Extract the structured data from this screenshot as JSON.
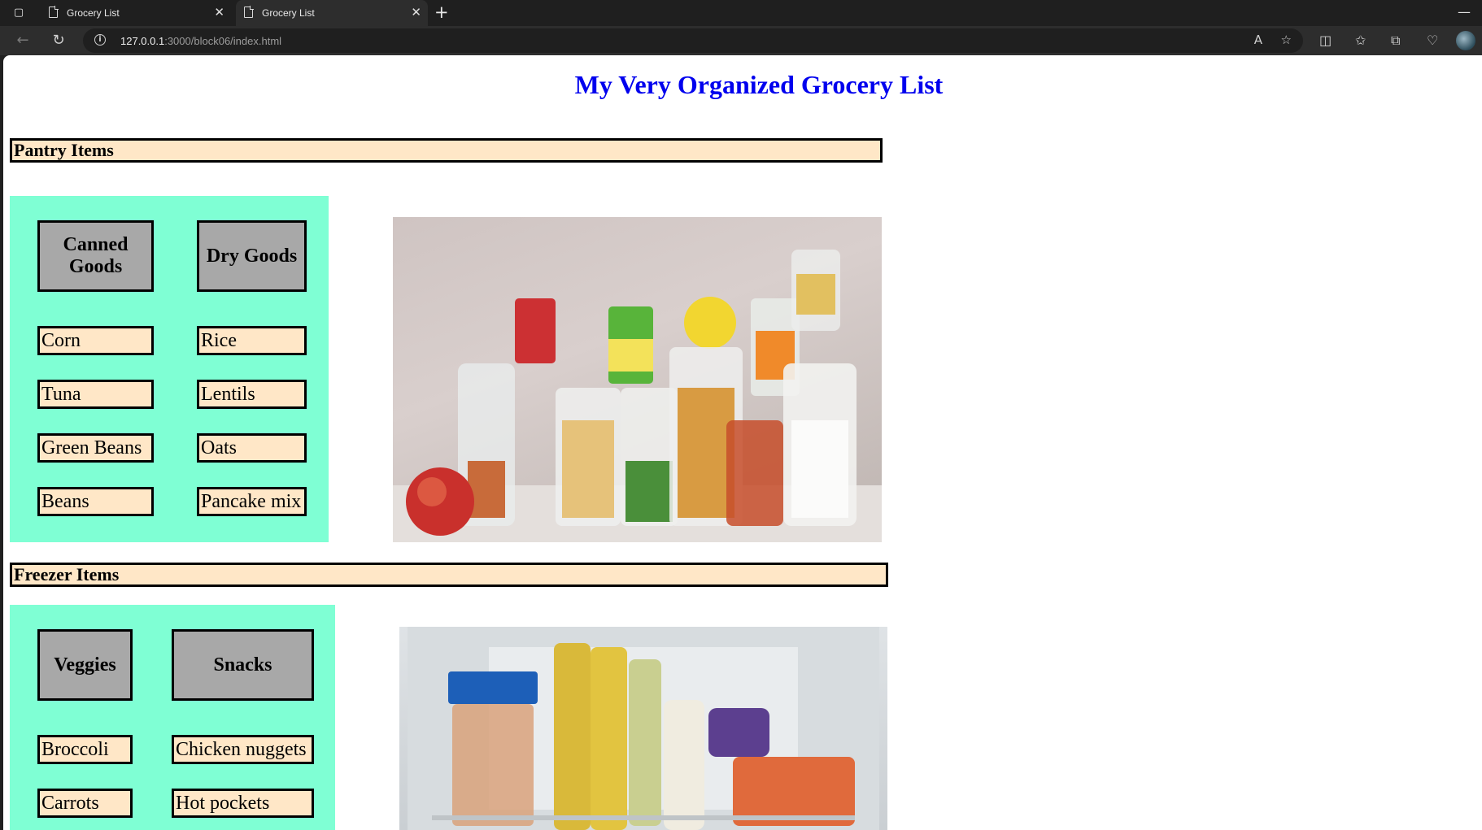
{
  "browser": {
    "tabs": [
      {
        "title": "Grocery List"
      },
      {
        "title": "Grocery List"
      }
    ],
    "url_host": "127.0.0.1",
    "url_path": ":3000/block06/index.html"
  },
  "page": {
    "title": "My Very Organized Grocery List",
    "sections": [
      {
        "header": "Pantry Items",
        "categories": [
          "Canned Goods",
          "Dry Goods"
        ],
        "columns": [
          [
            "Corn",
            "Tuna",
            "Green Beans",
            "Beans"
          ],
          [
            "Rice",
            "Lentils",
            "Oats",
            "Pancake mix"
          ]
        ]
      },
      {
        "header": "Freezer Items",
        "categories": [
          "Veggies",
          "Snacks"
        ],
        "columns": [
          [
            "Broccoli",
            "Carrots"
          ],
          [
            "Chicken nuggets",
            "Hot pockets"
          ]
        ]
      }
    ]
  },
  "colors": {
    "title": "#0000ee",
    "header_bg": "#ffe7c7",
    "panel_bg": "#7fffd4",
    "category_bg": "#a8a8a8"
  }
}
